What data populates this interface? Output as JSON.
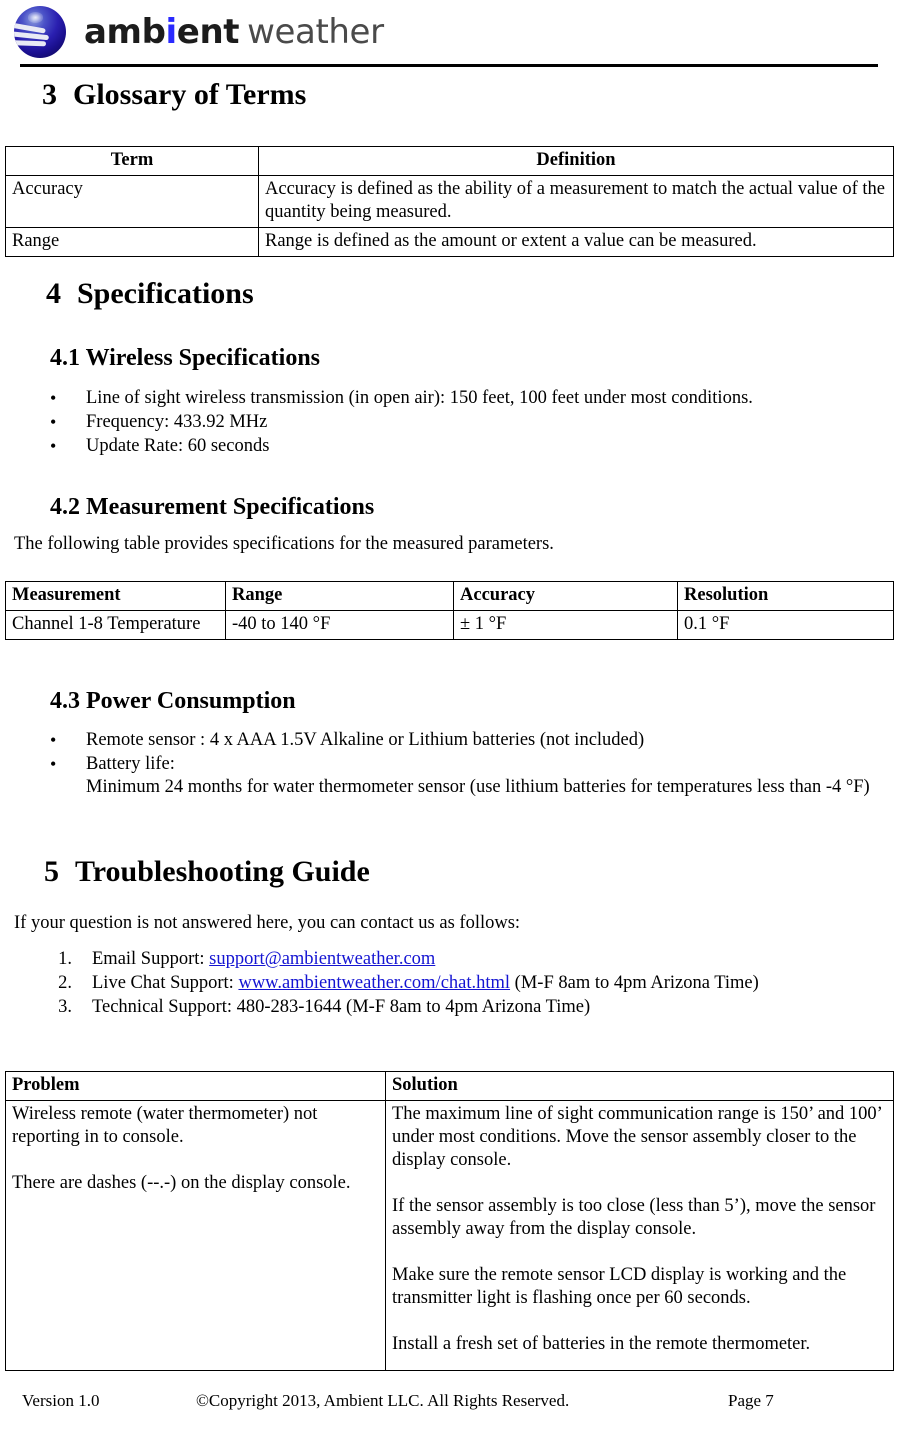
{
  "header": {
    "logo": {
      "icon_name": "ambient-weather-globe-logo",
      "word_bold": "ambient",
      "word_light": "weather",
      "globe_color": "#2a1fb0",
      "dot_color": "#2a2aff"
    }
  },
  "sections": {
    "glossary": {
      "number": "3",
      "title": "Glossary of Terms",
      "table": {
        "headers": [
          "Term",
          "Definition"
        ],
        "rows": [
          [
            "Accuracy",
            "Accuracy is defined as the ability of a measurement to match the actual value of the quantity being measured."
          ],
          [
            "Range",
            "Range is defined as the amount or extent a value can be measured."
          ]
        ]
      }
    },
    "specifications": {
      "number": "4",
      "title": "Specifications",
      "wireless": {
        "number": "4.1",
        "title": "4.1 Wireless Specifications",
        "bullets": [
          "Line of sight wireless transmission (in open air): 150 feet, 100 feet under most conditions.",
          "Frequency: 433.92 MHz",
          "Update Rate: 60 seconds"
        ]
      },
      "measurement": {
        "number": "4.2",
        "title": "4.2 Measurement Specifications",
        "intro": "The following table provides specifications for the measured parameters.",
        "table": {
          "headers": [
            "Measurement",
            "Range",
            "Accuracy",
            "Resolution"
          ],
          "rows": [
            [
              "Channel 1-8 Temperature",
              "-40 to 140 °F",
              "± 1 °F",
              "0.1 °F"
            ]
          ]
        }
      },
      "power": {
        "number": "4.3",
        "title": "4.3 Power Consumption",
        "bullets": [
          "Remote sensor : 4 x AAA 1.5V Alkaline or Lithium batteries (not included)",
          "Battery life:"
        ],
        "battery_detail": "Minimum 24 months for water thermometer sensor (use lithium batteries for temperatures less than -4 °F)"
      }
    },
    "troubleshooting": {
      "number": "5",
      "title": "Troubleshooting Guide",
      "intro": "If your question is not answered here, you can contact us as follows:",
      "contacts": [
        {
          "marker": "1.",
          "label": "Email Support: ",
          "link": "support@ambientweather.com",
          "suffix": ""
        },
        {
          "marker": "2.",
          "label": "Live Chat Support: ",
          "link": "www.ambientweather.com/chat.html",
          "suffix": " (M-F 8am to 4pm Arizona Time)"
        },
        {
          "marker": "3.",
          "label": "Technical Support: 480-283-1644 (M-F 8am to 4pm Arizona Time)",
          "link": "",
          "suffix": ""
        }
      ],
      "table": {
        "headers": [
          "Problem",
          "Solution"
        ],
        "problem_1": "Wireless remote (water thermometer) not reporting in to console.",
        "problem_2": "There are dashes (--.-) on the display console.",
        "solution_1": "The maximum line of sight communication range is 150’ and 100’ under most conditions. Move the sensor assembly closer to the display console.",
        "solution_2": "If the sensor assembly is too close (less than 5’), move the sensor assembly away from the display console.",
        "solution_3": "Make sure the remote sensor LCD display is working and the transmitter light is flashing once per 60 seconds.",
        "solution_4": "Install a fresh set of batteries in the remote thermometer."
      }
    }
  },
  "footer": {
    "version": "Version 1.0",
    "copyright": "©Copyright 2013, Ambient LLC. All Rights Reserved.",
    "page": "Page 7"
  },
  "link_color": "#1414d2"
}
